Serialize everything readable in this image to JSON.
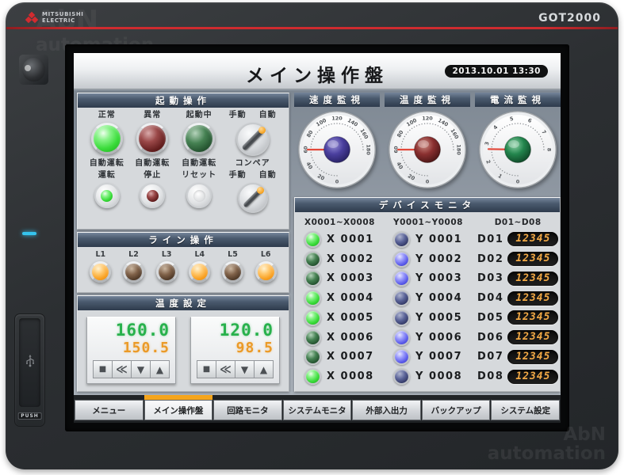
{
  "bezel": {
    "brand_line1": "MITSUBISHI",
    "brand_line2": "ELECTRIC",
    "model": "GOT2000",
    "usb_label": "PUSH",
    "watermark_line1": "AbN",
    "watermark_line2": "automation"
  },
  "titlebar": {
    "title": "メイン操作盤",
    "datetime": "2013.10.01 13:30"
  },
  "startup": {
    "header": "起動操作",
    "row1": [
      {
        "kind": "lamp",
        "label": "正常",
        "color": "green",
        "state": "on"
      },
      {
        "kind": "lamp",
        "label": "異常",
        "color": "red",
        "state": "off"
      },
      {
        "kind": "lamp",
        "label": "起動中",
        "color": "green",
        "state": "off"
      },
      {
        "kind": "selector",
        "label_left": "手動",
        "label_right": "自動",
        "selected": "自動"
      }
    ],
    "row2": [
      {
        "kind": "button",
        "label1": "自動運転",
        "label2": "運転",
        "color": "green",
        "state": "on"
      },
      {
        "kind": "button",
        "label1": "自動運転",
        "label2": "停止",
        "color": "red",
        "state": "off"
      },
      {
        "kind": "button",
        "label1": "自動運転",
        "label2": "リセット",
        "color": "plain",
        "state": "off"
      },
      {
        "kind": "selector",
        "label_top": "コンペア",
        "label_left": "手動",
        "label_right": "自動",
        "selected": "自動"
      }
    ]
  },
  "line": {
    "header": "ライン操作",
    "lamps": [
      {
        "label": "L1",
        "on": true
      },
      {
        "label": "L2",
        "on": false
      },
      {
        "label": "L3",
        "on": false
      },
      {
        "label": "L4",
        "on": true
      },
      {
        "label": "L5",
        "on": false
      },
      {
        "label": "L6",
        "on": true
      }
    ]
  },
  "temp": {
    "header": "温度設定",
    "buttons": [
      "■",
      "≪",
      "▼",
      "▲"
    ],
    "controllers": [
      {
        "value_top": "160.0",
        "value_bottom": "150.5"
      },
      {
        "value_top": "120.0",
        "value_bottom": "98.5"
      }
    ]
  },
  "gauges": [
    {
      "title": "速度監視",
      "min": 0,
      "max": 180,
      "tick_labels": [
        0,
        20,
        40,
        60,
        80,
        100,
        120,
        140,
        160,
        180
      ],
      "value": 60,
      "knob_light": "#9a92d8",
      "knob_color": "#4a3f9e",
      "knob_dark": "#201a56"
    },
    {
      "title": "温度監視",
      "min": 0,
      "max": 180,
      "tick_labels": [
        0,
        20,
        40,
        60,
        80,
        100,
        120,
        140,
        160,
        180
      ],
      "value": 60,
      "knob_light": "#cf8f85",
      "knob_color": "#8a3030",
      "knob_dark": "#3c0f0f"
    },
    {
      "title": "電流監視",
      "min": 0,
      "max": 8,
      "tick_labels": [
        0,
        1,
        2,
        3,
        4,
        5,
        6,
        7,
        8
      ],
      "value": 2.7,
      "knob_light": "#8fd3a8",
      "knob_color": "#23854d",
      "knob_dark": "#0b3a1f"
    }
  ],
  "device_monitor": {
    "header": "デバイスモニタ",
    "col_headers": [
      "X0001~X0008",
      "Y0001~Y0008",
      "D01~D08"
    ],
    "x": [
      {
        "label": "X 0001",
        "on": true
      },
      {
        "label": "X 0002",
        "on": false
      },
      {
        "label": "X 0003",
        "on": false
      },
      {
        "label": "X 0004",
        "on": true
      },
      {
        "label": "X 0005",
        "on": true
      },
      {
        "label": "X 0006",
        "on": false
      },
      {
        "label": "X 0007",
        "on": false
      },
      {
        "label": "X 0008",
        "on": true
      }
    ],
    "y": [
      {
        "label": "Y 0001",
        "on": false
      },
      {
        "label": "Y 0002",
        "on": true
      },
      {
        "label": "Y 0003",
        "on": true
      },
      {
        "label": "Y 0004",
        "on": false
      },
      {
        "label": "Y 0005",
        "on": false
      },
      {
        "label": "Y 0006",
        "on": true
      },
      {
        "label": "Y 0007",
        "on": true
      },
      {
        "label": "Y 0008",
        "on": false
      }
    ],
    "d": [
      {
        "label": "D01",
        "value": "12345"
      },
      {
        "label": "D02",
        "value": "12345"
      },
      {
        "label": "D03",
        "value": "12345"
      },
      {
        "label": "D04",
        "value": "12345"
      },
      {
        "label": "D05",
        "value": "12345"
      },
      {
        "label": "D06",
        "value": "12345"
      },
      {
        "label": "D07",
        "value": "12345"
      },
      {
        "label": "D08",
        "value": "12345"
      }
    ]
  },
  "tabs": [
    {
      "label": "メニュー",
      "active": false
    },
    {
      "label": "メイン操作盤",
      "active": true
    },
    {
      "label": "回路モニタ",
      "active": false
    },
    {
      "label": "システムモニタ",
      "active": false
    },
    {
      "label": "外部入出力",
      "active": false
    },
    {
      "label": "バックアップ",
      "active": false
    },
    {
      "label": "システム設定",
      "active": false
    }
  ],
  "colors": {
    "accent_orange": "#f5a51c",
    "header_bar": "#3c4a5c",
    "lamp_green": "#3bdc3b",
    "lamp_orange": "#f89e1e",
    "lamp_blue": "#5b5bea",
    "value_green": "#28b14c",
    "value_orange": "#eb9a27",
    "digit_amber": "#f2a945",
    "needle_red": "#e2493b",
    "bezel_red_line": "#cf2b2f",
    "power_led": "#35c4ee"
  }
}
